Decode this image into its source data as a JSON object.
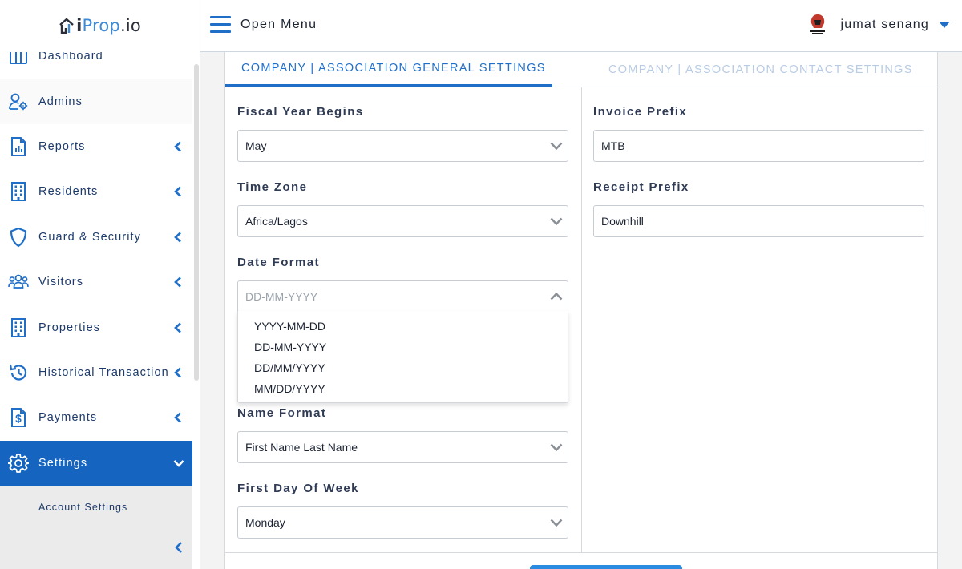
{
  "brand": {
    "part1": "i",
    "part2": "Prop",
    "part3": ".io"
  },
  "topbar": {
    "menu_label": "Open Menu",
    "user_name": "jumat senang"
  },
  "sidebar": {
    "items": [
      {
        "label": "Dashboard",
        "icon": "dashboard-icon",
        "has_chevron": false
      },
      {
        "label": "Admins",
        "icon": "admin-user-gear-icon",
        "has_chevron": false
      },
      {
        "label": "Reports",
        "icon": "report-icon",
        "has_chevron": true
      },
      {
        "label": "Residents",
        "icon": "building-icon",
        "has_chevron": true
      },
      {
        "label": "Guard & Security",
        "icon": "shield-icon",
        "has_chevron": true
      },
      {
        "label": "Visitors",
        "icon": "users-icon",
        "has_chevron": true
      },
      {
        "label": "Properties",
        "icon": "building-icon",
        "has_chevron": true
      },
      {
        "label": "Historical Transaction",
        "icon": "history-icon",
        "has_chevron": true
      },
      {
        "label": "Payments",
        "icon": "invoice-dollar-icon",
        "has_chevron": true
      },
      {
        "label": "Settings",
        "icon": "gear-icon",
        "has_chevron": true,
        "active": true
      }
    ],
    "submenu": {
      "account_settings": "Account Settings"
    }
  },
  "tabs": {
    "general": "COMPANY | ASSOCIATION GENERAL SETTINGS",
    "contact": "COMPANY | ASSOCIATION CONTACT SETTINGS"
  },
  "form": {
    "fiscal_year": {
      "label": "Fiscal Year Begins",
      "value": "May"
    },
    "time_zone": {
      "label": "Time Zone",
      "value": "Africa/Lagos"
    },
    "date_format": {
      "label": "Date Format",
      "placeholder": "DD-MM-YYYY",
      "options": [
        "YYYY-MM-DD",
        "DD-MM-YYYY",
        "DD/MM/YYYY",
        "MM/DD/YYYY"
      ]
    },
    "name_format": {
      "label": "Name Format",
      "value": "First Name Last Name"
    },
    "first_day": {
      "label": "First Day Of Week",
      "value": "Monday"
    },
    "invoice_prefix": {
      "label": "Invoice Prefix",
      "value": "MTB"
    },
    "receipt_prefix": {
      "label": "Receipt Prefix",
      "value": "Downhill"
    }
  },
  "colors": {
    "primary": "#1f6fc9",
    "active_nav": "#1565c0",
    "nav_text": "#1c3a6b",
    "inactive_tab": "#b9cce4"
  }
}
